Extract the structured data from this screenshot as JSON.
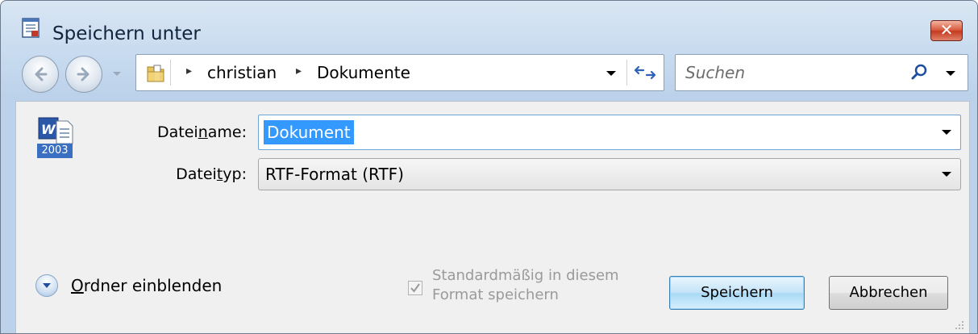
{
  "window": {
    "title": "Speichern unter",
    "close_label": "✕"
  },
  "nav": {
    "breadcrumbs": [
      {
        "label": "christian"
      },
      {
        "label": "Dokumente"
      }
    ],
    "search_placeholder": "Suchen"
  },
  "form": {
    "filename_label_pre": "Datei",
    "filename_label_key": "n",
    "filename_label_post": "ame:",
    "filename_value": "Dokument",
    "filetype_label_pre": "Datei",
    "filetype_label_key": "t",
    "filetype_label_post": "yp:",
    "filetype_value": "RTF-Format (RTF)",
    "doc_icon_badge": "2003"
  },
  "footer": {
    "toggle_folders_key": "O",
    "toggle_folders_rest": "rdner einblenden",
    "default_format_line1": "Standardmäßig in diesem",
    "default_format_line2": "Format speichern",
    "default_format_checked": true,
    "save_label": "Speichern",
    "cancel_label": "Abbrechen"
  },
  "colors": {
    "selection": "#3399ff",
    "close_red": "#c33a1e",
    "accent_border": "#3c7fb1"
  }
}
